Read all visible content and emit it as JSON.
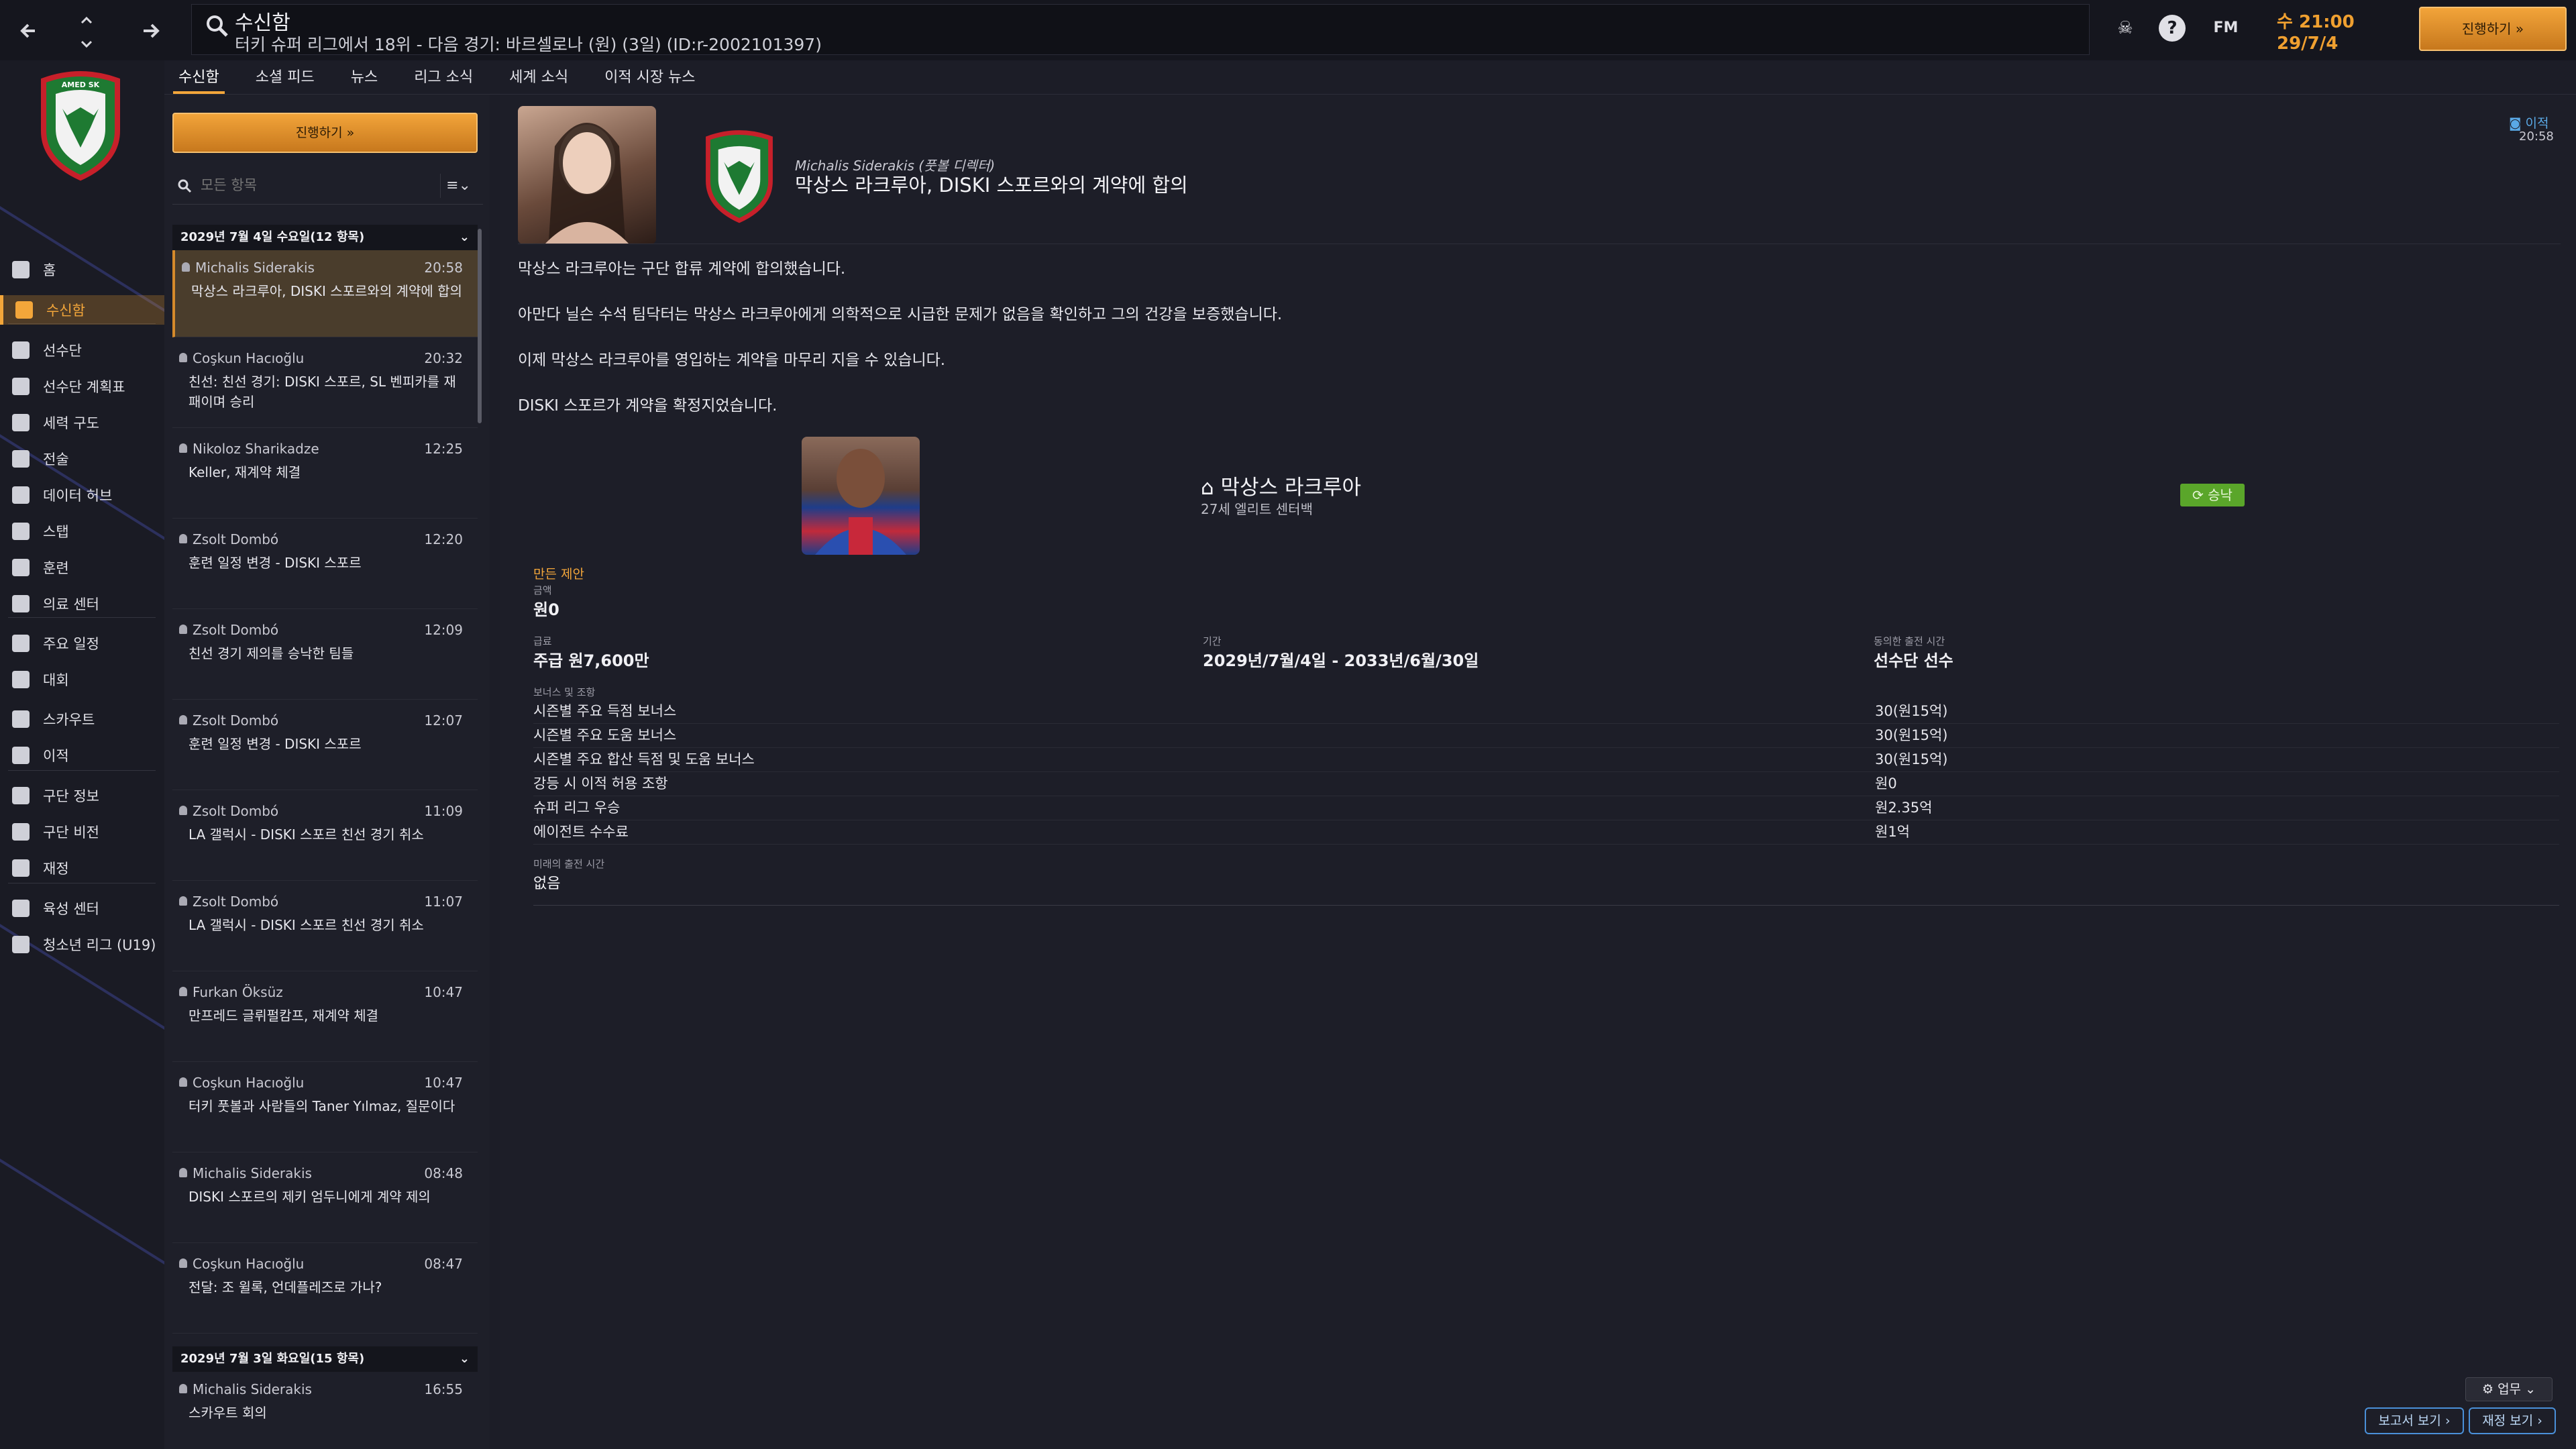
{
  "topbar": {
    "title": "수신함",
    "subtitle": "터키 슈퍼 리그에서 18위 - 다음 경기: 바르셀로나 (원) (3일) (ID:r-2002101397)",
    "fm_label": "FM",
    "time_day": "수 21:00",
    "time_date": "29/7/4",
    "continue_label": "진행하기"
  },
  "nav": {
    "items": [
      {
        "label": "홈",
        "icon": "home-icon"
      },
      {
        "label": "수신함",
        "icon": "inbox-icon"
      },
      {
        "label": "선수단",
        "icon": "shirt-icon"
      },
      {
        "label": "선수단 계획표",
        "icon": "clipboard-icon"
      },
      {
        "label": "세력 구도",
        "icon": "dynamics-icon"
      },
      {
        "label": "전술",
        "icon": "tactics-icon"
      },
      {
        "label": "데이터 허브",
        "icon": "data-hub-icon"
      },
      {
        "label": "스탭",
        "icon": "staff-icon"
      },
      {
        "label": "훈련",
        "icon": "training-icon"
      },
      {
        "label": "의료 센터",
        "icon": "medical-icon"
      },
      {
        "label": "주요 일정",
        "icon": "calendar-icon"
      },
      {
        "label": "대회",
        "icon": "trophy-icon"
      },
      {
        "label": "스카우트",
        "icon": "scout-icon"
      },
      {
        "label": "이적",
        "icon": "transfer-icon"
      },
      {
        "label": "구단 정보",
        "icon": "club-info-icon"
      },
      {
        "label": "구단 비전",
        "icon": "club-vision-icon"
      },
      {
        "label": "재정",
        "icon": "finance-icon"
      },
      {
        "label": "육성 센터",
        "icon": "development-icon"
      },
      {
        "label": "청소년 리그 (U19)",
        "icon": "youth-icon"
      }
    ]
  },
  "tabs": [
    "수신함",
    "소셜 피드",
    "뉴스",
    "리그 소식",
    "세계 소식",
    "이적 시장 뉴스"
  ],
  "list": {
    "continue_label": "진행하기",
    "filter_placeholder": "모든 항목",
    "group1": "2029년 7월 4일 수요일(12 항목)",
    "group2": "2029년 7월 3일 화요일(15 항목)",
    "messages": [
      {
        "who": "Michalis Siderakis",
        "time": "20:58",
        "subject": "막상스 라크루아, DISKI 스포르와의 계약에 합의"
      },
      {
        "who": "Coşkun Hacıoğlu",
        "time": "20:32",
        "subject": "친선: 친선 경기: DISKI 스포르, SL 벤피카를 재패이며 승리"
      },
      {
        "who": "Nikoloz Sharikadze",
        "time": "12:25",
        "subject": "Keller, 재계약 체결"
      },
      {
        "who": "Zsolt Dombó",
        "time": "12:20",
        "subject": "훈련 일정 변경 - DISKI 스포르"
      },
      {
        "who": "Zsolt Dombó",
        "time": "12:09",
        "subject": "친선 경기 제의를 승낙한 팀들"
      },
      {
        "who": "Zsolt Dombó",
        "time": "12:07",
        "subject": "훈련 일정 변경 - DISKI 스포르"
      },
      {
        "who": "Zsolt Dombó",
        "time": "11:09",
        "subject": "LA 갤럭시 - DISKI 스포르 친선 경기 취소"
      },
      {
        "who": "Zsolt Dombó",
        "time": "11:07",
        "subject": "LA 갤럭시 - DISKI 스포르 친선 경기 취소"
      },
      {
        "who": "Furkan Öksüz",
        "time": "10:47",
        "subject": "만프레드 글뤼펄캄프, 재계약 체결"
      },
      {
        "who": "Coşkun Hacıoğlu",
        "time": "10:47",
        "subject": "터키 풋볼과 사람들의 Taner Yılmaz, 질문이다"
      },
      {
        "who": "Michalis Siderakis",
        "time": "08:48",
        "subject": "DISKI 스포르의 제키 엄두니에게 계약 제의"
      },
      {
        "who": "Coşkun Hacıoğlu",
        "time": "08:47",
        "subject": "전달: 조 윌록, 언데플레즈로 가나?"
      },
      {
        "who": "Michalis Siderakis",
        "time": "16:55",
        "subject": "스카우트 회의"
      }
    ]
  },
  "message": {
    "sender": "Michalis Siderakis (풋볼 디렉터)",
    "headline": "막상스 라크루아, DISKI 스포르와의 계약에 합의",
    "flag": "이적",
    "time": "20:58",
    "paragraphs": [
      "막상스 라크루아는 구단 합류 계약에 합의했습니다.",
      "아만다 닐슨 수석 팀닥터는 막상스 라크루아에게 의학적으로 시급한 문제가 없음을 확인하고 그의 건강을 보증했습니다.",
      "이제 막상스 라크루아를 영입하는 계약을 마무리 지을 수 있습니다.",
      "DISKI 스포르가 계약을 확정지었습니다."
    ],
    "player_name": "막상스 라크루아",
    "player_desc": "27세 엘리트 센터백",
    "status": "승낙",
    "terms_title": "만든 제안",
    "fee_label": "금액",
    "fee_value": "원0",
    "wage_label": "급료",
    "wage_value": "주급 원7,600만",
    "period_label": "기간",
    "period_value": "2029년/7월/4일 - 2033년/6월/30일",
    "role_label": "동의한 출전 시간",
    "role_value": "선수단 선수",
    "bonus_label": "보너스 및 조항",
    "bonuses": [
      {
        "label": "시즌별 주요 득점 보너스",
        "value": "30(원15억)"
      },
      {
        "label": "시즌별 주요 도움 보너스",
        "value": "30(원15억)"
      },
      {
        "label": "시즌별 주요 합산 득점 및 도움 보너스",
        "value": "30(원15억)"
      },
      {
        "label": "강등 시 이적 허용 조항",
        "value": "원0"
      },
      {
        "label": "슈퍼 리그 우승",
        "value": "원2.35억"
      },
      {
        "label": "에이전트 수수료",
        "value": "원1억"
      }
    ],
    "future_label": "미래의 출전 시간",
    "future_value": "없음"
  },
  "footer": {
    "work_label": "업무",
    "report_label": "보고서 보기",
    "finance_label": "재정 보기"
  }
}
